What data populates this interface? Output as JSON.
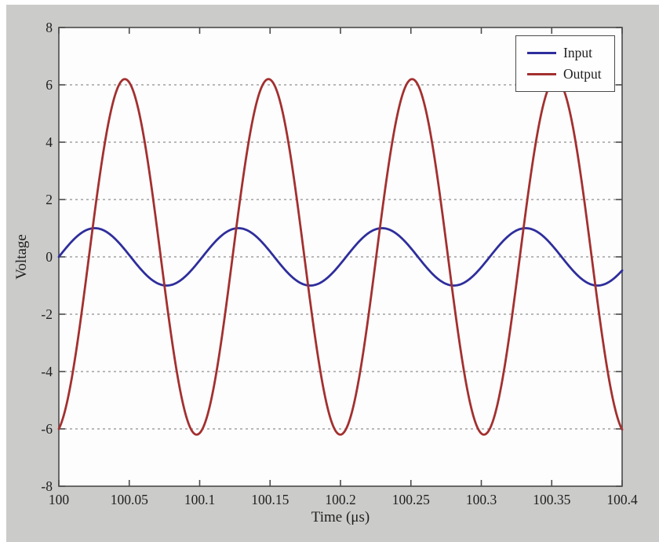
{
  "figure": {
    "xlabel": "Time (μs)",
    "ylabel": "Voltage",
    "panel_bg": "#cbcbca",
    "plot_bg": "#fdfdfd",
    "axis_color": "#4b4b4b",
    "grid_color": "#8f8f8f",
    "text_color": "#1f1f1f"
  },
  "legend": {
    "position": "top-right",
    "items": [
      {
        "label": "Input",
        "color": "#2e2e9c"
      },
      {
        "label": "Output",
        "color": "#a33030"
      }
    ]
  },
  "chart_data": {
    "type": "line",
    "title": "",
    "xlabel": "Time (μs)",
    "ylabel": "Voltage",
    "xlim": [
      100,
      100.4
    ],
    "ylim": [
      -8,
      8
    ],
    "x_ticks": [
      100,
      100.05,
      100.1,
      100.15,
      100.2,
      100.25,
      100.3,
      100.35,
      100.4
    ],
    "x_tick_labels": [
      "100",
      "100.05",
      "100.1",
      "100.15",
      "100.2",
      "100.25",
      "100.3",
      "100.35",
      "100.4"
    ],
    "y_ticks": [
      -8,
      -6,
      -4,
      -2,
      0,
      2,
      4,
      6,
      8
    ],
    "y_tick_labels": [
      "-8",
      "-6",
      "-4",
      "-2",
      "0",
      "2",
      "4",
      "6",
      "8"
    ],
    "grid": "horizontal-dashed",
    "legend_position": "top-right",
    "series": [
      {
        "name": "Input",
        "color": "#2e2e9c",
        "waveform": "sine",
        "amplitude": 1.0,
        "period_us": 0.102,
        "phase_deg": 0,
        "offset": 0,
        "description": "Input = 1.0*sin(2*pi*(t-100)/0.102) V; peaks ~+1 at t=100.026, 100.128, 100.230, 100.332"
      },
      {
        "name": "Output",
        "color": "#a33030",
        "waveform": "sine",
        "amplitude": 6.2,
        "period_us": 0.102,
        "phase_deg": -75.4,
        "offset": 0,
        "description": "Output = 6.2*sin(2*pi*(t-100)/0.102 - 75.4deg) V; starts at -6.0, peaks ~+6.2 at t=100.047, 100.149, 100.251, 100.353"
      }
    ]
  }
}
